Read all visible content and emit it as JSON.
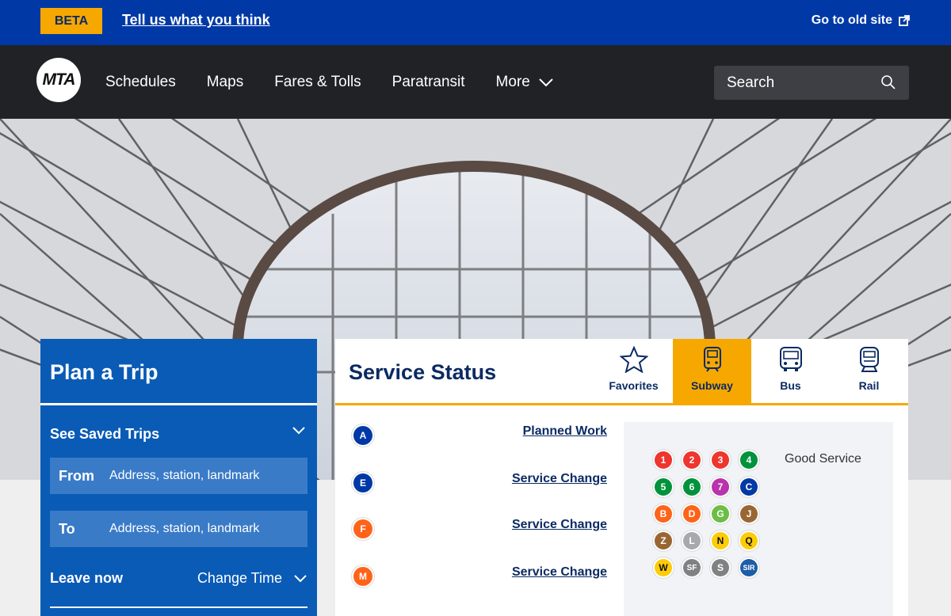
{
  "beta_bar": {
    "badge": "BETA",
    "feedback_link": "Tell us what you think",
    "old_site_link": "Go to old site"
  },
  "nav": {
    "logo": "MTA",
    "items": [
      "Schedules",
      "Maps",
      "Fares & Tolls",
      "Paratransit",
      "More"
    ],
    "search_placeholder": "Search"
  },
  "plan_trip": {
    "title": "Plan a Trip",
    "saved_trips": "See Saved Trips",
    "from_label": "From",
    "from_placeholder": "Address, station, landmark",
    "to_label": "To",
    "to_placeholder": "Address, station, landmark",
    "leave_now": "Leave now",
    "change_time": "Change Time"
  },
  "service_status": {
    "title": "Service Status",
    "tabs": [
      {
        "label": "Favorites",
        "icon": "star-icon"
      },
      {
        "label": "Subway",
        "icon": "subway-icon",
        "active": true
      },
      {
        "label": "Bus",
        "icon": "bus-icon"
      },
      {
        "label": "Rail",
        "icon": "rail-icon"
      }
    ],
    "lines": [
      {
        "line": "A",
        "status": "Planned Work",
        "color": "#0039a6"
      },
      {
        "line": "E",
        "status": "Service Change",
        "color": "#0039a6"
      },
      {
        "line": "F",
        "status": "Service Change",
        "color": "#ff6319"
      },
      {
        "line": "M",
        "status": "Service Change",
        "color": "#ff6319"
      }
    ],
    "good_service": {
      "label": "Good Service",
      "lines": [
        {
          "line": "1",
          "color": "#ee352e"
        },
        {
          "line": "2",
          "color": "#ee352e"
        },
        {
          "line": "3",
          "color": "#ee352e"
        },
        {
          "line": "4",
          "color": "#00933c"
        },
        {
          "line": "5",
          "color": "#00933c"
        },
        {
          "line": "6",
          "color": "#00933c"
        },
        {
          "line": "7",
          "color": "#b933ad"
        },
        {
          "line": "C",
          "color": "#0039a6"
        },
        {
          "line": "B",
          "color": "#ff6319"
        },
        {
          "line": "D",
          "color": "#ff6319"
        },
        {
          "line": "G",
          "color": "#6cbe45"
        },
        {
          "line": "J",
          "color": "#996633"
        },
        {
          "line": "Z",
          "color": "#996633"
        },
        {
          "line": "L",
          "color": "#a7a9ac"
        },
        {
          "line": "N",
          "color": "#fccc0a"
        },
        {
          "line": "Q",
          "color": "#fccc0a"
        },
        {
          "line": "W",
          "color": "#fccc0a"
        },
        {
          "line": "SF",
          "color": "#808183"
        },
        {
          "line": "S",
          "color": "#808183"
        },
        {
          "line": "SIR",
          "color": "#1d5da8"
        }
      ]
    }
  },
  "colors": {
    "brand_blue": "#0039a6",
    "accent_yellow": "#f6a800",
    "nav_dark": "#212226"
  }
}
